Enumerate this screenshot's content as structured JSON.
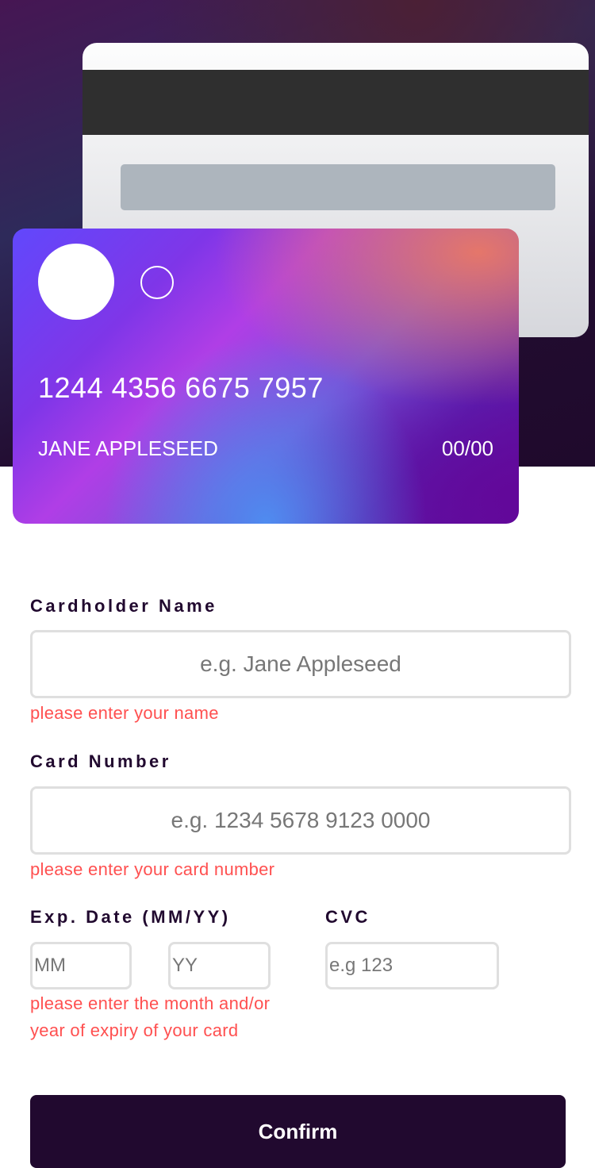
{
  "card": {
    "number": "1244 4356 6675 7957",
    "name": "JANE APPLESEED",
    "expiry": "00/00"
  },
  "form": {
    "name_label": "Cardholder Name",
    "name_placeholder": "e.g. Jane Appleseed",
    "name_error": "please enter your name",
    "number_label": "Card Number",
    "number_placeholder": "e.g. 1234 5678 9123 0000",
    "number_error": "please enter your card number",
    "exp_label": "Exp. Date (MM/YY)",
    "mm_placeholder": "MM",
    "yy_placeholder": "YY",
    "exp_error": "please enter the month and/or year of expiry of your card",
    "cvc_label": "CVC",
    "cvc_placeholder": "e.g 123",
    "confirm_label": "Confirm"
  },
  "colors": {
    "accent": "#21092f",
    "error": "#ff5050",
    "border": "#dfdfdf"
  }
}
